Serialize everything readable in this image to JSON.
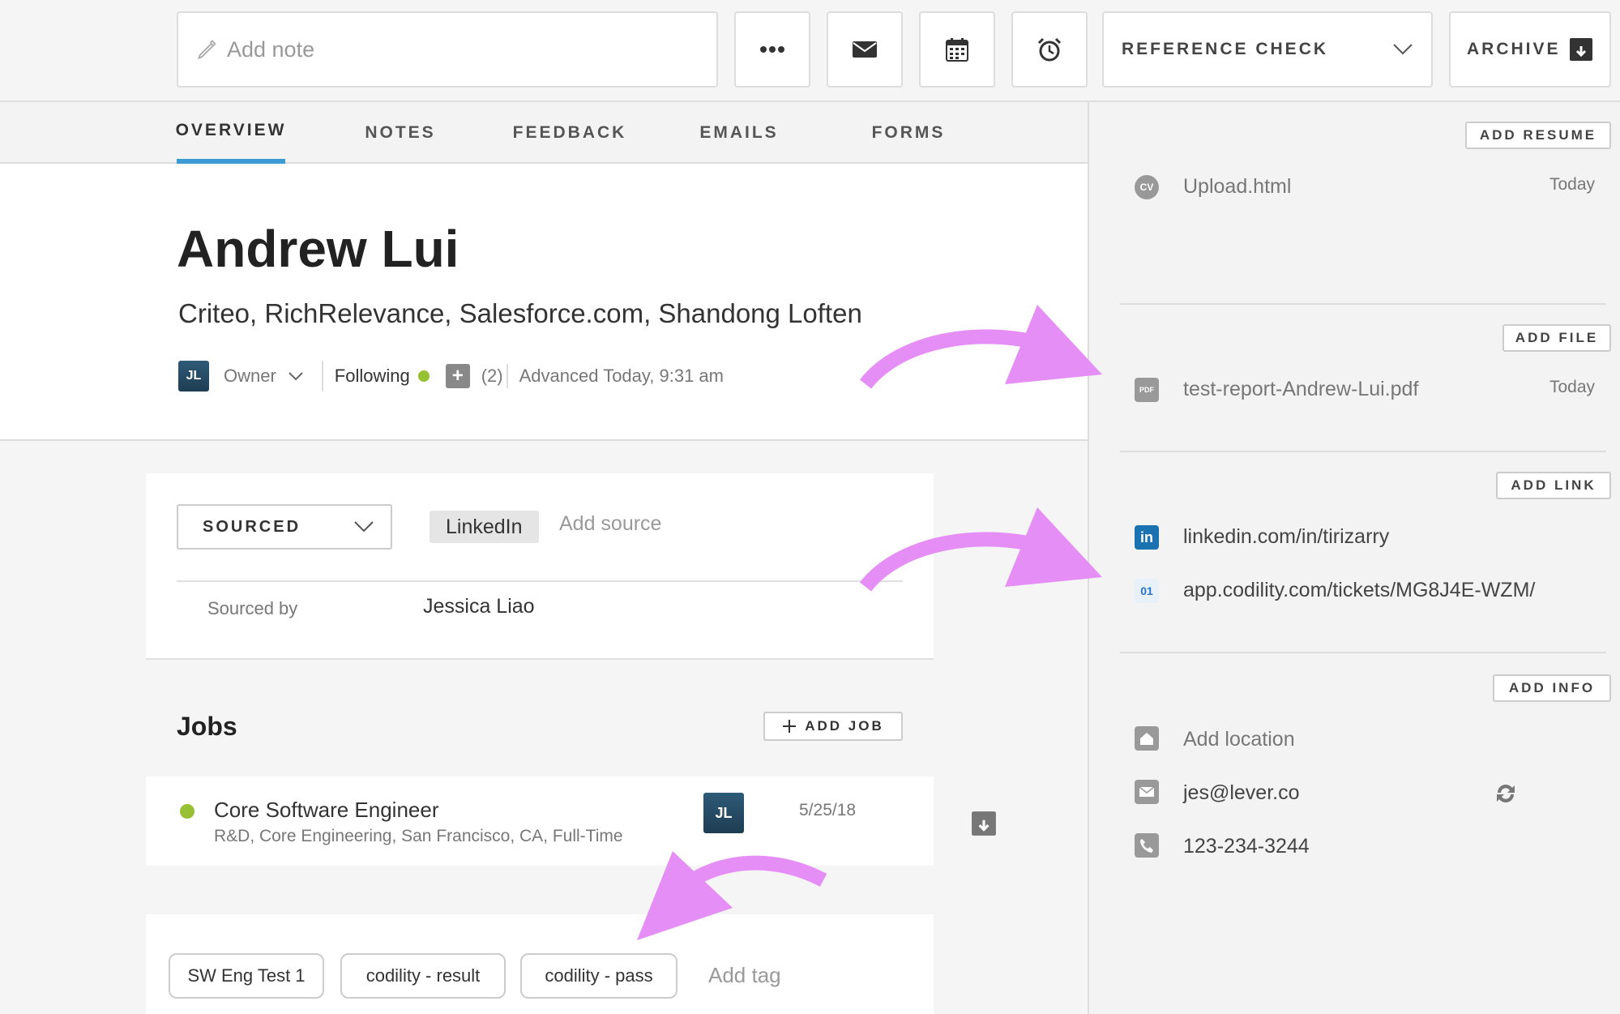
{
  "toolbar": {
    "note_placeholder": "Add note",
    "stage": "REFERENCE CHECK",
    "archive_label": "ARCHIVE"
  },
  "tabs": [
    {
      "label": "OVERVIEW"
    },
    {
      "label": "NOTES"
    },
    {
      "label": "FEEDBACK"
    },
    {
      "label": "EMAILS"
    },
    {
      "label": "FORMS"
    }
  ],
  "candidate": {
    "name": "Andrew Lui",
    "companies": "Criteo, RichRelevance, Salesforce.com, Shandong Loften",
    "owner_initials": "JL",
    "owner_label": "Owner",
    "following_label": "Following",
    "followers_count": "(2)",
    "advanced_text": "Advanced Today, 9:31 am"
  },
  "source": {
    "dropdown": "SOURCED",
    "chip": "LinkedIn",
    "add_source": "Add source",
    "sourced_by_label": "Sourced by",
    "sourced_by_value": "Jessica Liao"
  },
  "jobs": {
    "title": "Jobs",
    "add_label": "ADD JOB",
    "items": [
      {
        "title": "Core Software Engineer",
        "subtitle": "R&D, Core Engineering, San Francisco, CA, Full-Time",
        "initials": "JL",
        "date": "5/25/18"
      }
    ]
  },
  "tags": {
    "items": [
      "SW Eng Test 1",
      "codility - result",
      "codility - pass"
    ],
    "add_label": "Add tag"
  },
  "sidebar": {
    "resume": {
      "button": "ADD RESUME",
      "file": "Upload.html",
      "date": "Today",
      "icon_text": "CV"
    },
    "file": {
      "button": "ADD FILE",
      "file": "test-report-Andrew-Lui.pdf",
      "date": "Today",
      "icon_text": "PDF"
    },
    "links": {
      "button": "ADD LINK",
      "items": [
        {
          "text": "linkedin.com/in/tirizarry",
          "icon_text": "in"
        },
        {
          "text": "app.codility.com/tickets/MG8J4E-WZM/",
          "icon_text": "01"
        }
      ]
    },
    "info": {
      "button": "ADD INFO",
      "location": "Add location",
      "email": "jes@lever.co",
      "phone": "123-234-3244"
    }
  },
  "colors": {
    "accent": "#3d9bd4",
    "status_green": "#97c034",
    "annotation_arrow": "#e58ef5"
  }
}
